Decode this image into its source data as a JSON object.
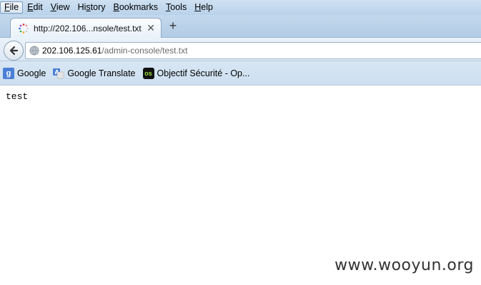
{
  "menu": {
    "items": [
      {
        "pre": "",
        "ul": "F",
        "post": "ile"
      },
      {
        "pre": "",
        "ul": "E",
        "post": "dit"
      },
      {
        "pre": "",
        "ul": "V",
        "post": "iew"
      },
      {
        "pre": "Hi",
        "ul": "s",
        "post": "tory"
      },
      {
        "pre": "",
        "ul": "B",
        "post": "ookmarks"
      },
      {
        "pre": "",
        "ul": "T",
        "post": "ools"
      },
      {
        "pre": "",
        "ul": "H",
        "post": "elp"
      }
    ]
  },
  "tab": {
    "title": "http://202.106...nsole/test.txt",
    "close_glyph": "✕",
    "new_tab_glyph": "+"
  },
  "navbar": {
    "back_icon": "back-arrow-icon",
    "url_host": "202.106.125.61",
    "url_path": "/admin-console/test.txt"
  },
  "bookmarks": [
    {
      "label": "Google",
      "icon": "google-icon",
      "glyph": "g"
    },
    {
      "label": "Google Translate",
      "icon": "translate-icon",
      "glyph": ""
    },
    {
      "label": "Objectif Sécurité - Op...",
      "icon": "objectif-securite-icon",
      "glyph": "os"
    }
  ],
  "page": {
    "text": "test"
  },
  "watermark": "www.wooyun.org",
  "colors": {
    "menubar": "#c5dbef",
    "tab_active": "#f4f8fc",
    "url_path": "#6b6b6b"
  }
}
